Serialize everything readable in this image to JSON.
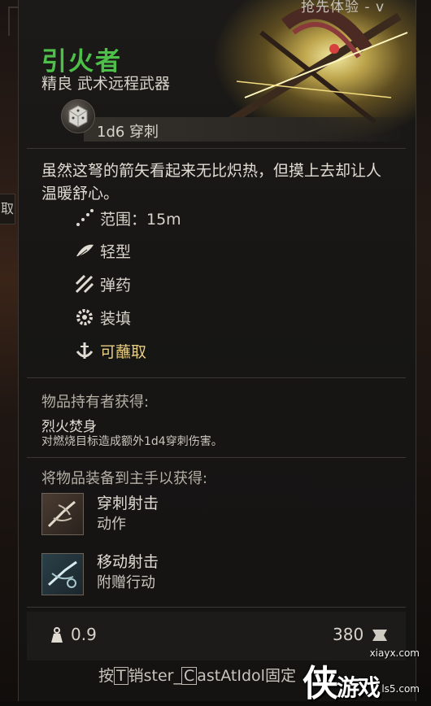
{
  "banner": {
    "text": "抢先体验 - v"
  },
  "left_tab": {
    "label": "取"
  },
  "item": {
    "name": "引火者",
    "subtitle": "精良 武术远程武器",
    "damage": "1d6 穿刺",
    "description": "虽然这弩的箭矢看起来无比炽热，但摸上去却让人温暖舒心。",
    "name_color": "#4ec04a"
  },
  "properties": [
    {
      "label": "范围：15m",
      "icon": "range-icon"
    },
    {
      "label": "轻型",
      "icon": "feather-icon"
    },
    {
      "label": "弹药",
      "icon": "ammo-icon"
    },
    {
      "label": "装填",
      "icon": "gear-icon"
    },
    {
      "label": "可蘸取",
      "icon": "dip-icon",
      "color": "#e8cf84"
    }
  ],
  "holder_section": {
    "heading": "物品持有者获得:",
    "passive_name": "烈火焚身",
    "passive_desc": "对燃烧目标造成额外1d4穿刺伤害。"
  },
  "mainhand_section": {
    "heading": "将物品装备到主手以获得:",
    "actions": [
      {
        "name": "穿刺射击",
        "type": "动作",
        "icon": "piercing-shot-icon"
      },
      {
        "name": "移动射击",
        "type": "附赠行动",
        "icon": "mobile-shot-icon"
      }
    ]
  },
  "footer": {
    "weight": "0.9",
    "price": "380",
    "hint_prefix": "按",
    "hint_key": "T",
    "hint_text": "销ster_",
    "hint_key2": "C",
    "hint_text2": "astAtIdol固定"
  },
  "watermark": {
    "logo_text": "侠",
    "logo_text2": "游戏",
    "url_top": "xiayx.com",
    "url_bottom": "ls5.com"
  }
}
